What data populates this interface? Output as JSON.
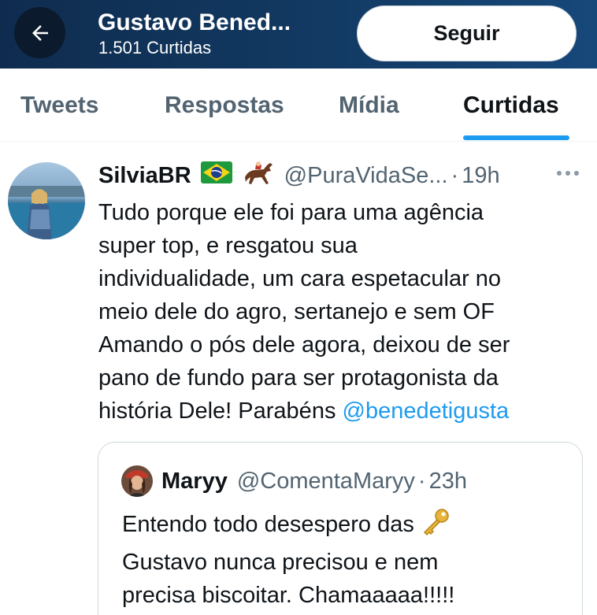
{
  "header": {
    "title": "Gustavo Bened...",
    "subtitle": "1.501 Curtidas",
    "follow_label": "Seguir",
    "back_icon": "arrow-left-icon",
    "gradient_colors": [
      "#0f2c4f",
      "#17487a"
    ]
  },
  "tabs": [
    {
      "label": "Tweets",
      "active": false
    },
    {
      "label": "Respostas",
      "active": false
    },
    {
      "label": "Mídia",
      "active": false
    },
    {
      "label": "Curtidas",
      "active": true
    }
  ],
  "tweet": {
    "author": "SilviaBR",
    "emojis": [
      "brazil-flag-icon",
      "horse-racing-icon"
    ],
    "handle": "@PuraVidaSe...",
    "separator": "·",
    "time": "19h",
    "more_icon": "more-horizontal-icon",
    "body_lines": [
      "Tudo porque ele foi para uma agência",
      "super top, e resgatou sua",
      "individualidade,  um cara espetacular no",
      "meio dele do agro, sertanejo e sem OF",
      "Amando o  pós dele agora, deixou de ser",
      "pano de fundo para ser protagonista da"
    ],
    "last_line_text": "história Dele! Parabéns ",
    "mention": "@benedetigusta"
  },
  "quoted_tweet": {
    "author": "Maryy",
    "handle": "@ComentaMaryy",
    "separator": "·",
    "time": "23h",
    "line1_text": "Entendo todo desespero das",
    "line1_emoji": "key-icon",
    "line2": "Gustavo nunca precisou e nem",
    "line3": "precisa biscoitar. Chamaaaaa!!!!!"
  },
  "colors": {
    "accent": "#1d9bf0",
    "text_primary": "#0f1419",
    "text_secondary": "#536471",
    "border": "#cfd9de"
  }
}
